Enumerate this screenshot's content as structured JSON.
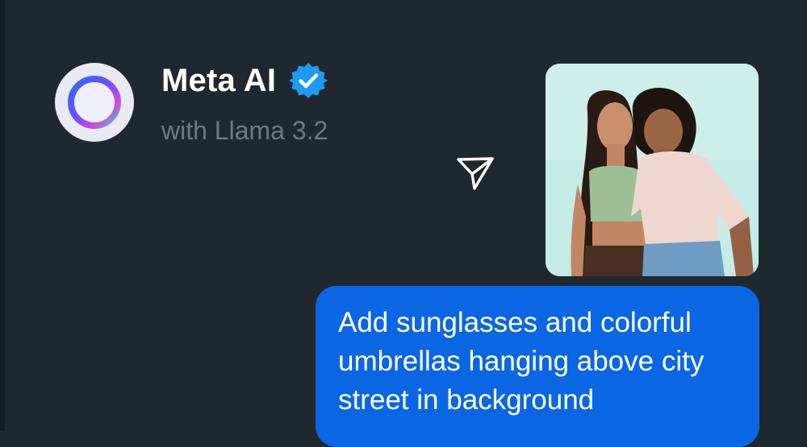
{
  "header": {
    "title": "Meta AI",
    "subtitle": "with Llama 3.2",
    "verified_icon": "verified-badge-icon",
    "avatar_icon": "meta-ai-ring-icon"
  },
  "actions": {
    "send_icon": "send-icon"
  },
  "message": {
    "attachment": "photo-two-women",
    "text": "Add sunglasses and colorful umbrellas hanging above city street in background"
  },
  "colors": {
    "background": "#1f282f",
    "bubble": "#0b66e4",
    "verified": "#1d9bf0",
    "subtitle": "#6f7880"
  }
}
